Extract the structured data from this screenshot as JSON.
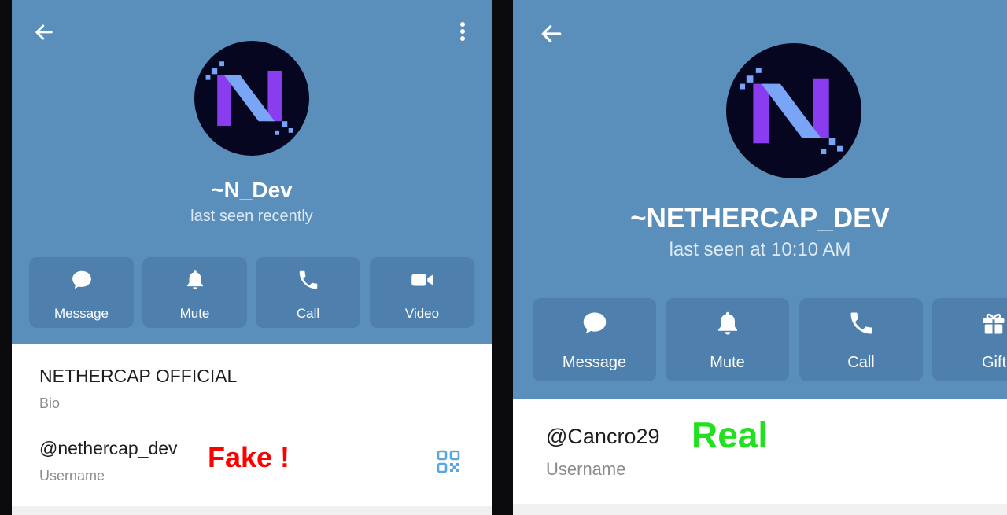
{
  "left": {
    "back_icon": "back-arrow-icon",
    "menu_icon": "more-vertical-icon",
    "display_name": "~N_Dev",
    "status": "last seen recently",
    "actions": [
      {
        "label": "Message",
        "icon": "chat-bubble-icon"
      },
      {
        "label": "Mute",
        "icon": "bell-icon"
      },
      {
        "label": "Call",
        "icon": "phone-icon"
      },
      {
        "label": "Video",
        "icon": "video-camera-icon"
      }
    ],
    "bio": {
      "value": "NETHERCAP OFFICIAL",
      "label": "Bio"
    },
    "username": {
      "value": "@nethercap_dev",
      "label": "Username"
    },
    "annotation": "Fake !",
    "qr_icon": "qr-code-icon"
  },
  "right": {
    "back_icon": "back-arrow-icon",
    "display_name": "~NETHERCAP_DEV",
    "status": "last seen at 10:10 AM",
    "actions": [
      {
        "label": "Message",
        "icon": "chat-bubble-icon"
      },
      {
        "label": "Mute",
        "icon": "bell-icon"
      },
      {
        "label": "Call",
        "icon": "phone-icon"
      },
      {
        "label": "Gift",
        "icon": "gift-icon"
      }
    ],
    "username": {
      "value": "@Cancro29",
      "label": "Username"
    },
    "annotation": "Real"
  },
  "colors": {
    "header": "#5b8fbb",
    "action_tile": "#4f80ad",
    "fake": "#ff0000",
    "real": "#22e01f",
    "qr": "#5aa7df",
    "avatar_bg": "#060620"
  }
}
